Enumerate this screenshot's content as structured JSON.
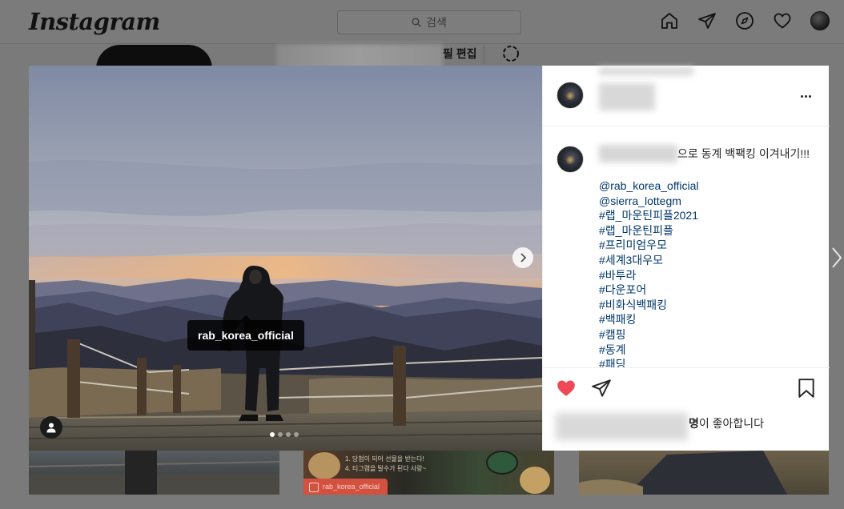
{
  "app": {
    "logo": "Instagram",
    "search_placeholder": "검색",
    "nav_icons": [
      "home-icon",
      "direct-icon",
      "explore-icon",
      "activity-heart-icon",
      "profile-avatar"
    ]
  },
  "profile_bg": {
    "edit_profile_label": "필 편집"
  },
  "post": {
    "photo_tag": "rab_korea_official",
    "carousel_count": 4,
    "carousel_active_index": 0,
    "caption_text": "으로 동계 백팩킹 이겨내기!!!",
    "caption_lines": [
      "@rab_korea_official",
      "@sierra_lottegm",
      "#랩_마운틴피플2021",
      "#랩_마운틴피플",
      "#프리미엄우모",
      "#세계3대우모",
      "#바투라",
      "#다운포어",
      "#비화식백패킹",
      "#백패킹",
      "#캠핑",
      "#동계",
      "#패딩"
    ],
    "likes_bold": "명",
    "likes_suffix": "이 좋아합니다",
    "liked": true,
    "like_color": "#ed4956"
  },
  "thumbnails": {
    "second_tag": "rab_korea_official",
    "second_text_lines": [
      "1. 당첨이 되어 선물을 받는다!",
      "4. 티그램을 탈수가 된다 사랑~"
    ]
  }
}
